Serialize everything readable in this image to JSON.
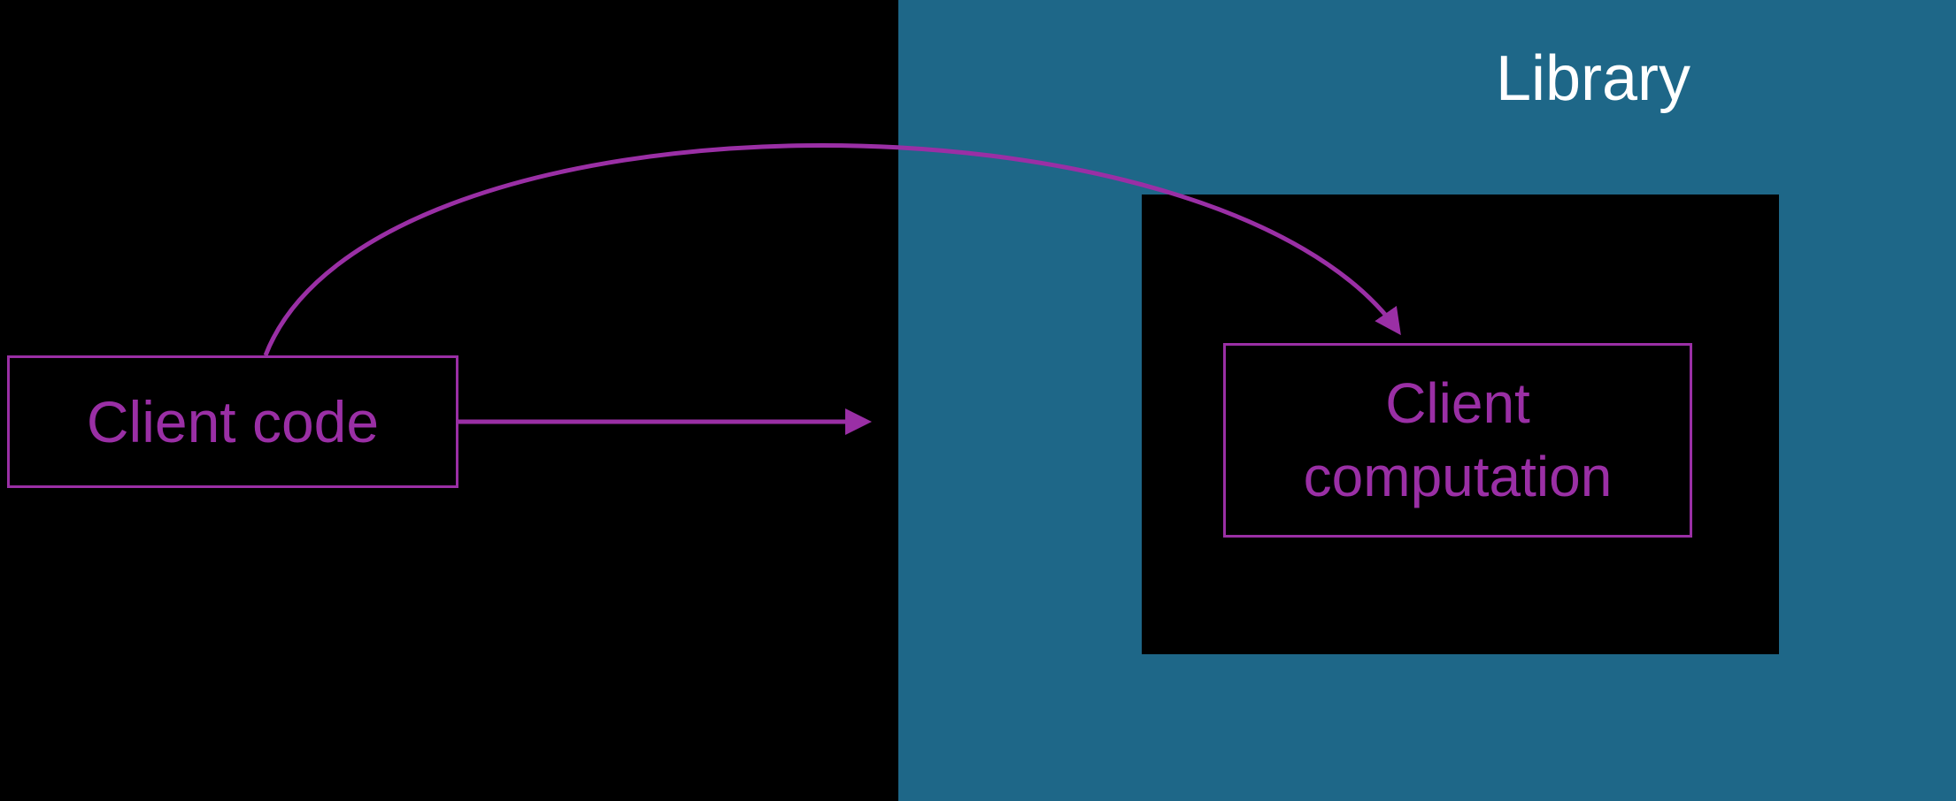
{
  "library_region": {
    "title": "Library"
  },
  "client_code": {
    "label": "Client code"
  },
  "client_computation": {
    "label": "Client\ncomputation"
  },
  "colors": {
    "background_black": "#000000",
    "library_teal": "#1e6788",
    "arrow_purple": "#9a2fa5",
    "text_white": "#ffffff"
  },
  "arrows": {
    "straight": {
      "from": "client-code-box",
      "to": "library-region-edge",
      "style": "straight",
      "color": "#9a2fa5"
    },
    "curved": {
      "from": "client-code-box",
      "to": "client-computation-box",
      "style": "curved",
      "color": "#9a2fa5"
    }
  }
}
